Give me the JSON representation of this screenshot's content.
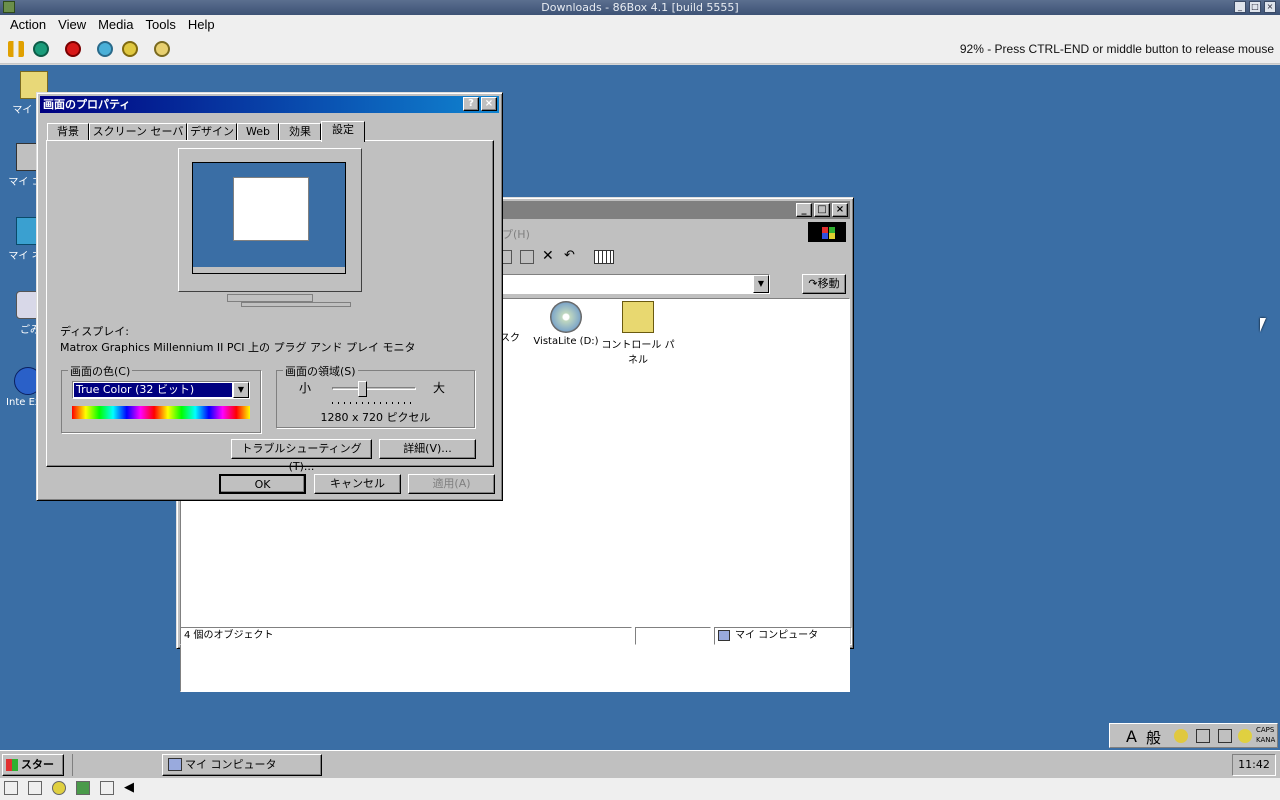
{
  "host": {
    "title": "Downloads - 86Box 4.1 [build 5555]",
    "menu": [
      "Action",
      "View",
      "Media",
      "Tools",
      "Help"
    ],
    "status": "92% - Press CTRL-END or middle button to release mouse"
  },
  "desktop_icons": [
    "マイ ドキ",
    "マイ コン",
    "マイ ネッ",
    "ごみ",
    "Inte Expl"
  ],
  "explorer": {
    "menu_partial": "プ(H)",
    "go_label": "移動",
    "items": [
      "スク",
      "VistaLite (D:)",
      "コントロール パネル"
    ],
    "status_count": "4 個のオブジェクト",
    "status_location": "マイ コンピュータ"
  },
  "props": {
    "title": "画面のプロパティ",
    "tabs": [
      "背景",
      "スクリーン セーバー",
      "デザイン",
      "Web",
      "効果",
      "設定"
    ],
    "display_label": "ディスプレイ:",
    "display_value": "Matrox Graphics Millennium II PCI 上の プラグ アンド プレイ モニタ",
    "colors_label": "画面の色(C)",
    "colors_value": "True Color (32 ビット)",
    "area_label": "画面の領域(S)",
    "area_small": "小",
    "area_large": "大",
    "area_value": "1280 x 720 ピクセル",
    "resolution_slider_position": 0.35,
    "troubleshoot_btn": "トラブルシューティング(T)...",
    "advanced_btn": "詳細(V)...",
    "ok_btn": "OK",
    "cancel_btn": "キャンセル",
    "apply_btn": "適用(A)"
  },
  "taskbar": {
    "start": "スタート",
    "task": "マイ コンピュータ",
    "clock": "11:42",
    "ime": [
      "A",
      "般",
      "CAPS",
      "KANA"
    ]
  },
  "colors": {
    "desktop": "#3a6ea5",
    "title_active": "#000080",
    "title_inactive": "#808080",
    "face": "#c0c0c0"
  }
}
